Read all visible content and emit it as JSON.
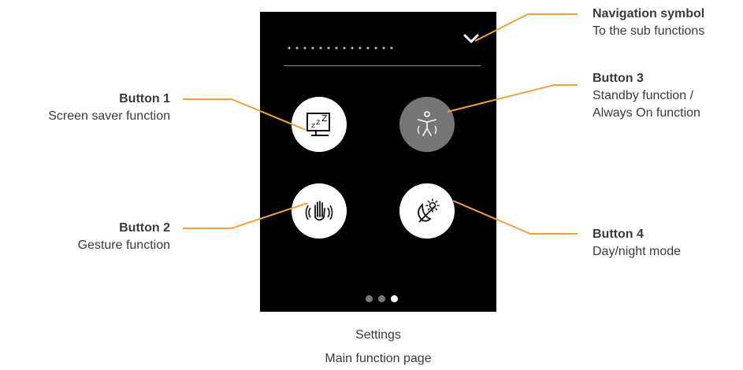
{
  "labels": {
    "nav": {
      "title": "Navigation symbol",
      "desc": "To the sub functions"
    },
    "b1": {
      "title": "Button 1",
      "desc": "Screen saver function"
    },
    "b2": {
      "title": "Button 2",
      "desc": "Gesture function"
    },
    "b3": {
      "title": "Button 3",
      "desc1": "Standby function /",
      "desc2": "Always On function"
    },
    "b4": {
      "title": "Button 4",
      "desc": "Day/night mode"
    }
  },
  "caption": {
    "line1": "Settings",
    "line2": "Main function page"
  },
  "icons": {
    "nav": "chevron-down-icon",
    "b1": "screen-saver-icon",
    "b2": "gesture-hand-icon",
    "b3": "standby-person-icon",
    "b4": "day-night-icon"
  },
  "pager": {
    "total": 3,
    "active": 3
  },
  "colors": {
    "leader": "#f0a23a",
    "screen": "#000000",
    "active_button": "#767676"
  }
}
